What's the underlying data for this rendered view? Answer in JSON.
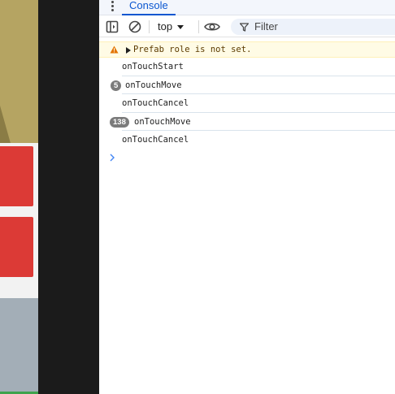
{
  "devtools": {
    "tab_label": "Console",
    "toolbar": {
      "context_value": "top",
      "filter_label": "Filter"
    }
  },
  "console": {
    "messages": [
      {
        "level": "warning",
        "text": "Prefab role is not set.",
        "expandable": true
      },
      {
        "level": "log",
        "text": "onTouchStart"
      },
      {
        "level": "log",
        "text": "onTouchMove",
        "repeat_count": "5"
      },
      {
        "level": "log",
        "text": "onTouchCancel"
      },
      {
        "level": "log",
        "text": "onTouchMove",
        "repeat_count": "138"
      },
      {
        "level": "log",
        "text": "onTouchCancel"
      }
    ]
  },
  "colors": {
    "accent": "#0b57d0",
    "warning_bg": "#fffbe5",
    "warning_icon": "#e37400",
    "badge": "#7b7b7b",
    "game_bg": "#b5a462",
    "game_button": "#dc3a36"
  }
}
